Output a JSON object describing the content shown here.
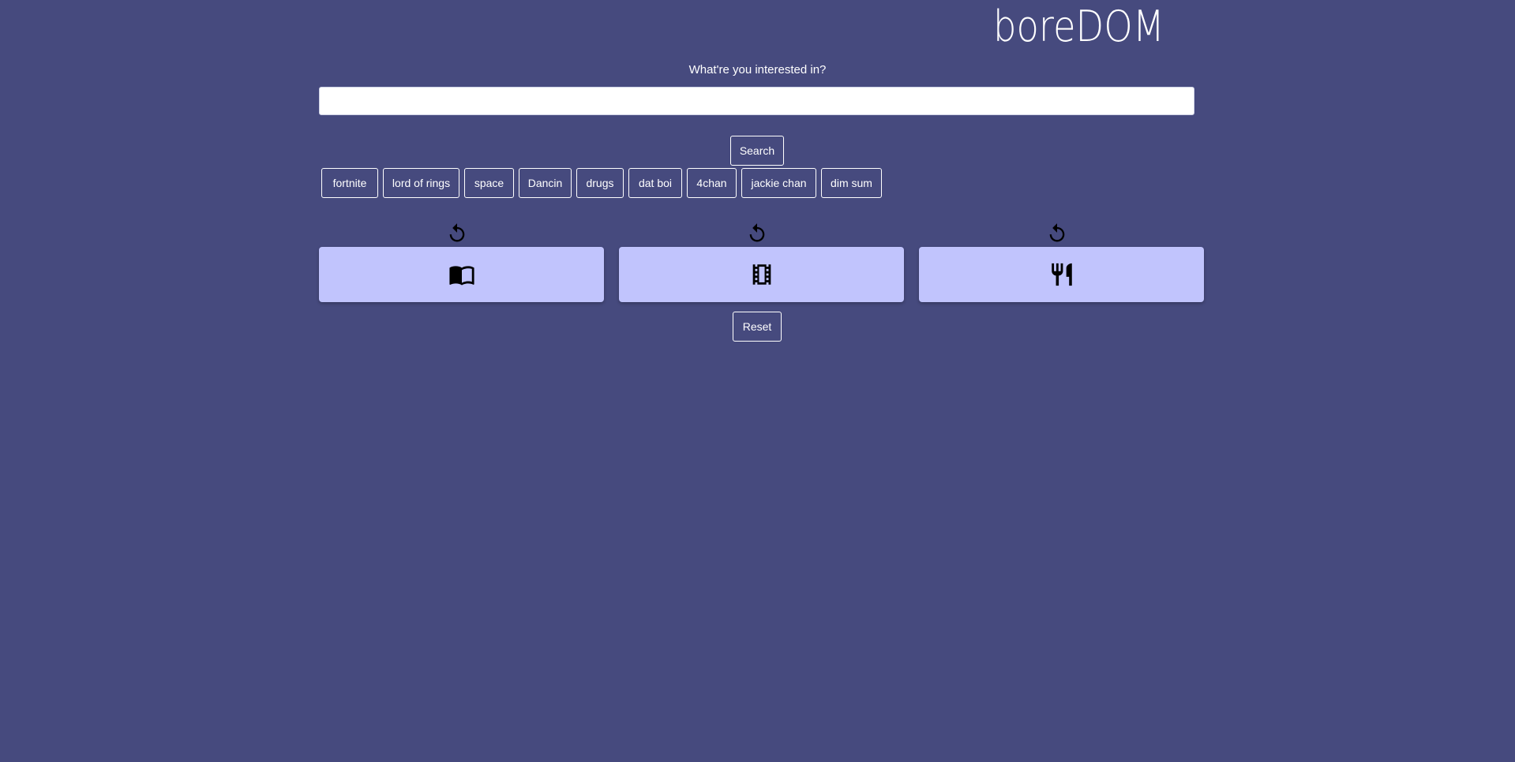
{
  "header": {
    "logo": "boreDOM"
  },
  "search": {
    "prompt": "What're you interested in?",
    "value": "",
    "placeholder": "",
    "button_label": "Search"
  },
  "suggestions": [
    "fortnite",
    "lord of rings",
    "space",
    "Dancin",
    "drugs",
    "dat boi",
    "4chan",
    "jackie chan",
    "dim sum"
  ],
  "categories": [
    {
      "icon": "book-icon",
      "refresh_icon": "refresh-icon"
    },
    {
      "icon": "film-icon",
      "refresh_icon": "refresh-icon"
    },
    {
      "icon": "restaurant-icon",
      "refresh_icon": "refresh-icon"
    }
  ],
  "actions": {
    "reset_label": "Reset"
  },
  "colors": {
    "background": "#464a7e",
    "card": "#c1c4fd",
    "text": "#ffffff"
  }
}
